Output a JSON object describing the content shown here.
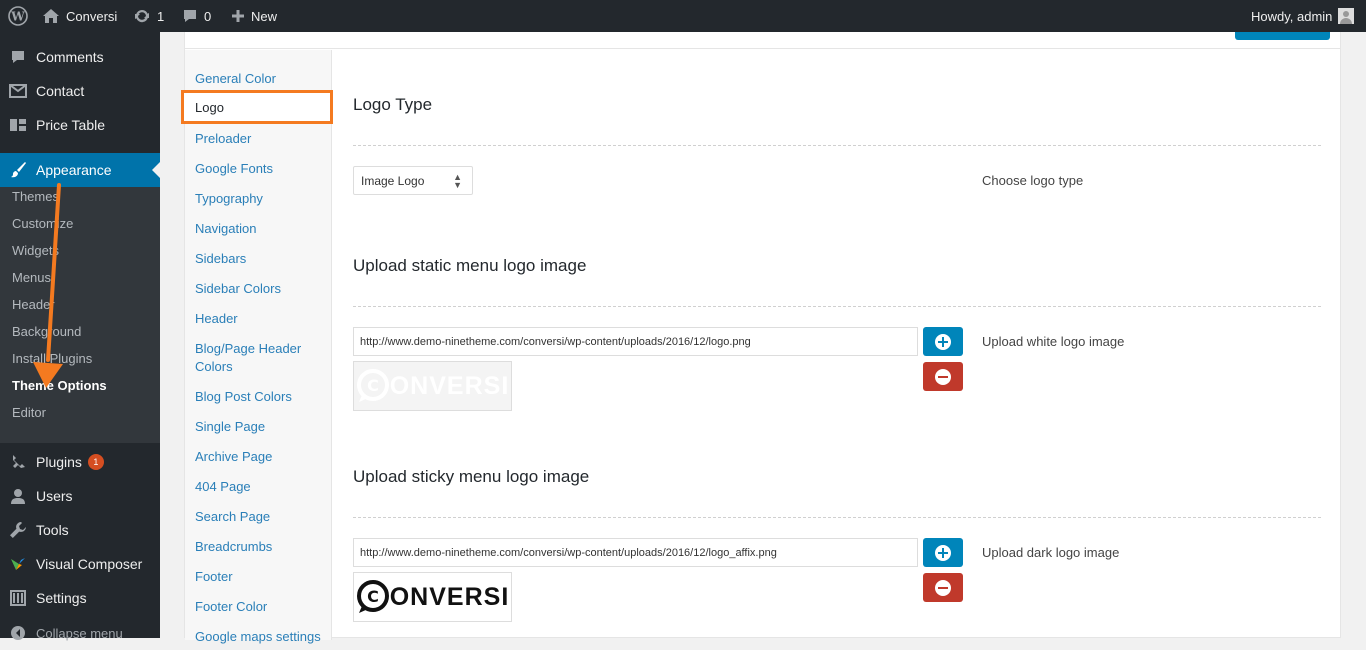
{
  "adminbar": {
    "site": "Conversi",
    "updates": "1",
    "comments": "0",
    "new_label": "New",
    "greeting": "Howdy, admin"
  },
  "menu": {
    "comments": "Comments",
    "contact": "Contact",
    "price_table": "Price Table",
    "appearance": "Appearance",
    "plugins": "Plugins",
    "plugins_badge": "1",
    "users": "Users",
    "tools": "Tools",
    "visual_composer": "Visual Composer",
    "settings": "Settings",
    "collapse": "Collapse menu",
    "sub": [
      "Themes",
      "Customize",
      "Widgets",
      "Menus",
      "Header",
      "Background",
      "Install Plugins",
      "Theme Options",
      "Editor"
    ]
  },
  "tabs": [
    "General Color",
    "Logo",
    "Preloader",
    "Google Fonts",
    "Typography",
    "Navigation",
    "Sidebars",
    "Sidebar Colors",
    "Header",
    "Blog/Page Header Colors",
    "Blog Post Colors",
    "Single Page",
    "Archive Page",
    "404 Page",
    "Search Page",
    "Breadcrumbs",
    "Footer",
    "Footer Color",
    "Google maps settings"
  ],
  "logo_type": {
    "title": "Logo Type",
    "selected": "Image Logo",
    "desc": "Choose logo type"
  },
  "static_logo": {
    "title": "Upload static menu logo image",
    "url": "http://www.demo-ninetheme.com/conversi/wp-content/uploads/2016/12/logo.png",
    "desc": "Upload white logo image",
    "preview": "ONVERSI"
  },
  "sticky_logo": {
    "title": "Upload sticky menu logo image",
    "url": "http://www.demo-ninetheme.com/conversi/wp-content/uploads/2016/12/logo_affix.png",
    "desc": "Upload dark logo image",
    "preview": "ONVERSI"
  },
  "colors": {
    "accent": "#0073aa",
    "highlight": "#f47a20",
    "danger": "#c0392b"
  }
}
